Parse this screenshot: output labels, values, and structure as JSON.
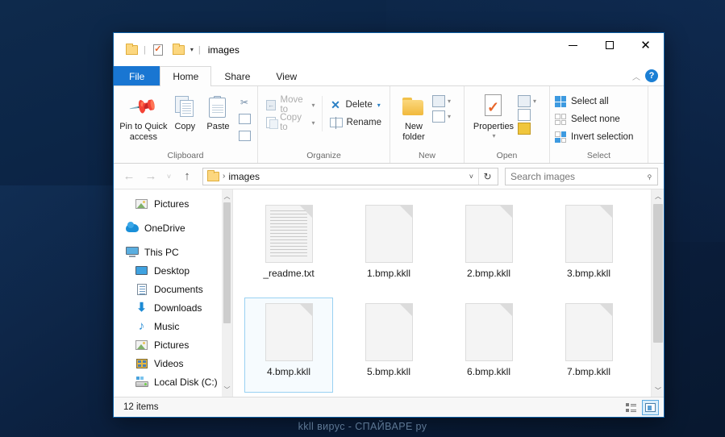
{
  "window": {
    "title": "images",
    "quick_access": {
      "folder_icon": "folder-icon",
      "properties_icon": "properties-icon",
      "new_folder_icon": "new-folder-icon",
      "dropdown_caret": "▾"
    },
    "controls": {
      "minimize": "minimize-icon",
      "maximize": "maximize-icon",
      "close": "✕"
    }
  },
  "tabs": [
    {
      "label": "File",
      "key": "file"
    },
    {
      "label": "Home",
      "key": "home"
    },
    {
      "label": "Share",
      "key": "share"
    },
    {
      "label": "View",
      "key": "view"
    }
  ],
  "tab_right": {
    "collapse_ribbon": "︿",
    "help": "?"
  },
  "ribbon": {
    "groups": [
      {
        "title": "Clipboard"
      },
      {
        "title": "Organize"
      },
      {
        "title": "New"
      },
      {
        "title": "Open"
      },
      {
        "title": "Select"
      }
    ],
    "clipboard": {
      "pin_label_line1": "Pin to Quick",
      "pin_label_line2": "access",
      "copy_label": "Copy",
      "paste_label": "Paste",
      "cut_icon": "✂",
      "copy_path_icon": "copy-path-icon",
      "paste_shortcut_icon": "paste-shortcut-icon"
    },
    "organize": {
      "move_to": "Move to",
      "copy_to": "Copy to",
      "delete": "Delete",
      "rename": "Rename"
    },
    "new": {
      "new_folder_line1": "New",
      "new_folder_line2": "folder",
      "new_item_icon": "new-item-icon",
      "easy_access_icon": "easy-access-icon"
    },
    "open": {
      "properties": "Properties",
      "open_icon": "open-icon",
      "edit_icon": "edit-icon",
      "history_icon": "history-icon"
    },
    "select": {
      "select_all": "Select all",
      "select_none": "Select none",
      "invert_selection": "Invert selection"
    }
  },
  "addressbar": {
    "back_icon": "←",
    "forward_icon": "→",
    "recent_icon": "˅",
    "up_icon": "↑",
    "path": "images",
    "crumb_separator": "›",
    "dropdown_icon": "˅",
    "refresh_icon": "↻",
    "search_placeholder": "Search images",
    "search_icon": "search-icon"
  },
  "sidebar": {
    "items": [
      {
        "label": "Pictures",
        "icon": "pictures-icon",
        "indent": true
      },
      {
        "label": "OneDrive",
        "icon": "onedrive-icon",
        "indent": false
      },
      {
        "label": "This PC",
        "icon": "this-pc-icon",
        "indent": false
      },
      {
        "label": "Desktop",
        "icon": "desktop-icon",
        "indent": true
      },
      {
        "label": "Documents",
        "icon": "documents-icon",
        "indent": true
      },
      {
        "label": "Downloads",
        "icon": "downloads-icon",
        "indent": true
      },
      {
        "label": "Music",
        "icon": "music-icon",
        "indent": true
      },
      {
        "label": "Pictures",
        "icon": "pictures-icon",
        "indent": true
      },
      {
        "label": "Videos",
        "icon": "videos-icon",
        "indent": true
      },
      {
        "label": "Local Disk (C:)",
        "icon": "local-disk-icon",
        "indent": true
      }
    ],
    "scroll_up": "︿",
    "scroll_down": "﹀"
  },
  "files": {
    "row1": [
      {
        "name": "_readme.txt",
        "type": "text",
        "selected": false
      },
      {
        "name": "1.bmp.kkll",
        "type": "blank",
        "selected": false
      },
      {
        "name": "2.bmp.kkll",
        "type": "blank",
        "selected": false
      },
      {
        "name": "3.bmp.kkll",
        "type": "blank",
        "selected": false
      }
    ],
    "row2": [
      {
        "name": "4.bmp.kkll",
        "type": "blank",
        "selected": true
      },
      {
        "name": "5.bmp.kkll",
        "type": "blank",
        "selected": false
      },
      {
        "name": "6.bmp.kkll",
        "type": "blank",
        "selected": false
      },
      {
        "name": "7.bmp.kkll",
        "type": "blank",
        "selected": false
      }
    ],
    "scroll_up": "︿",
    "scroll_down": "﹀"
  },
  "statusbar": {
    "item_count": "12 items",
    "details_view_icon": "details-view-icon",
    "large_icons_view_icon": "large-icons-view-icon"
  },
  "watermark": "kkll вирус - СПАЙВАРЕ ру",
  "colors": {
    "accent": "#1976d2",
    "selection": "#99d1f2",
    "desktop": "#0b2344",
    "delete_icon": "#2a7fc4"
  }
}
